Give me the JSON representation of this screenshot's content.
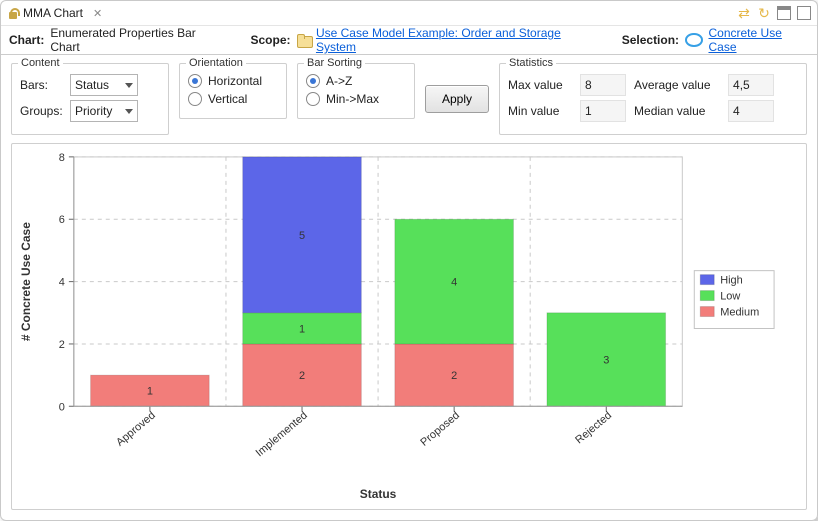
{
  "window": {
    "title": "MMA Chart"
  },
  "header": {
    "chart_label": "Chart:",
    "chart_value": "Enumerated Properties Bar Chart",
    "scope_label": "Scope:",
    "scope_link": "Use Case Model Example: Order and Storage System",
    "selection_label": "Selection:",
    "selection_link": "Concrete Use Case"
  },
  "controls": {
    "content": {
      "legend": "Content",
      "bars_label": "Bars:",
      "bars_value": "Status",
      "groups_label": "Groups:",
      "groups_value": "Priority"
    },
    "orientation": {
      "legend": "Orientation",
      "horizontal": "Horizontal",
      "vertical": "Vertical"
    },
    "bar_sorting": {
      "legend": "Bar Sorting",
      "az": "A->Z",
      "minmax": "Min->Max"
    },
    "apply_label": "Apply",
    "statistics": {
      "legend": "Statistics",
      "max_label": "Max value",
      "max_value": "8",
      "avg_label": "Average value",
      "avg_value": "4,5",
      "min_label": "Min value",
      "min_value": "1",
      "med_label": "Median value",
      "med_value": "4"
    }
  },
  "chart_data": {
    "type": "bar",
    "stacked": true,
    "title": "",
    "xlabel": "Status",
    "ylabel": "# Concrete Use Case",
    "ylim": [
      0,
      8
    ],
    "yticks": [
      0,
      2,
      4,
      6,
      8
    ],
    "categories": [
      "Approved",
      "Implemented",
      "Proposed",
      "Rejected"
    ],
    "series": [
      {
        "name": "Medium",
        "color": "#f27d7a",
        "values": [
          1,
          2,
          2,
          0
        ]
      },
      {
        "name": "Low",
        "color": "#57e05a",
        "values": [
          0,
          1,
          4,
          3
        ]
      },
      {
        "name": "High",
        "color": "#5c66e8",
        "values": [
          0,
          5,
          0,
          0
        ]
      }
    ],
    "legend_order": [
      "High",
      "Low",
      "Medium"
    ]
  }
}
